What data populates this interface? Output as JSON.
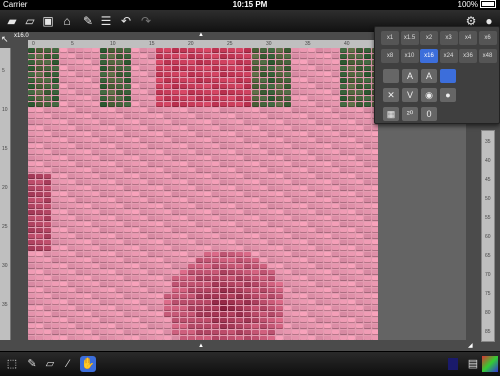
{
  "status": {
    "carrier": "Carrier",
    "time": "10:15 PM",
    "battery": "100%"
  },
  "toolbar": {
    "left": [
      "folder-icon",
      "folder-open-icon",
      "save-icon",
      "export-icon",
      "share-icon",
      "list-icon",
      "undo-icon",
      "redo-icon"
    ],
    "right": [
      "settings-icon",
      "help-icon"
    ]
  },
  "zoom": {
    "label": "x16.0"
  },
  "ruler_top": [
    "0",
    "5",
    "10",
    "15",
    "20",
    "25",
    "30",
    "35",
    "40"
  ],
  "ruler_bottom": [
    "5",
    "10",
    "15",
    "20",
    "25",
    "30",
    "35",
    "40"
  ],
  "ruler_left": [
    "5",
    "10",
    "15",
    "20",
    "25",
    "30",
    "35"
  ],
  "ruler_right": [
    "35",
    "40",
    "45",
    "50",
    "55",
    "60",
    "65",
    "70",
    "75",
    "80",
    "85"
  ],
  "zoom_options": [
    "x1",
    "x1.5",
    "x2",
    "x3",
    "x4",
    "x6",
    "x8",
    "x10",
    "x16",
    "x24",
    "x36",
    "x48"
  ],
  "zoom_selected": "x16",
  "view_options": [
    "plain",
    "letter-a",
    "letter-a-outline",
    "full",
    "x",
    "v",
    "circle",
    "sphere",
    "grid",
    "numbers",
    "oval"
  ],
  "bottom_tools": [
    "select-icon",
    "pencil-icon",
    "eraser-icon",
    "picker-icon",
    "hand-icon"
  ],
  "bottom_right": [
    "color-swatch-icon",
    "stamp-icon",
    "palette-icon"
  ]
}
